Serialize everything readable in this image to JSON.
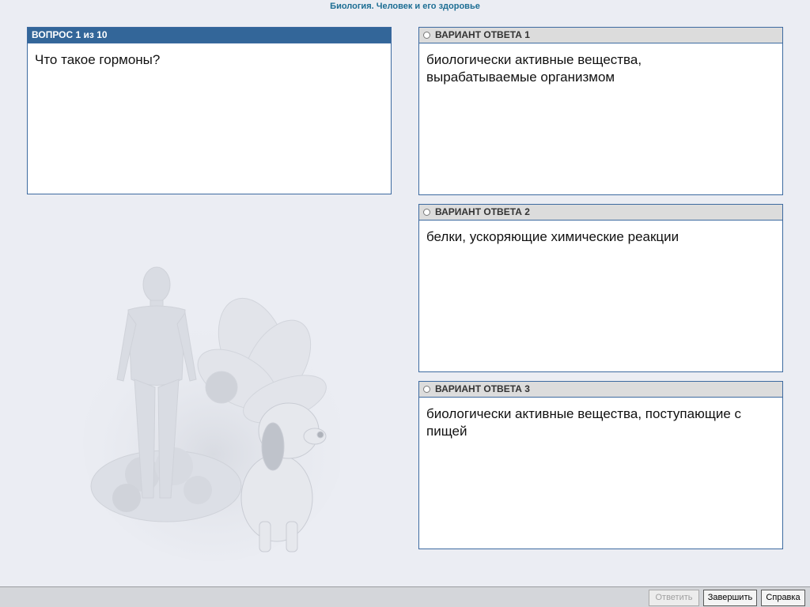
{
  "app": {
    "title": "Биология. Человек и его здоровье"
  },
  "question": {
    "header": "ВОПРОС 1 из 10",
    "text": "Что такое гормоны?"
  },
  "answers": [
    {
      "header": "ВАРИАНТ ОТВЕТА 1",
      "text": "биологически активные вещества, вырабатываемые организмом"
    },
    {
      "header": "ВАРИАНТ ОТВЕТА 2",
      "text": "белки, ускоряющие химические реакции"
    },
    {
      "header": "ВАРИАНТ ОТВЕТА 3",
      "text": "биологически активные вещества, поступающие с пищей"
    }
  ],
  "buttons": {
    "answer": "Ответить",
    "finish": "Завершить",
    "help": "Справка"
  },
  "colors": {
    "background": "#ebedf3",
    "question_header": "#336699",
    "answer_header": "#dcdcdc",
    "panel_border": "#3d6aa0",
    "title": "#1d6e94"
  }
}
